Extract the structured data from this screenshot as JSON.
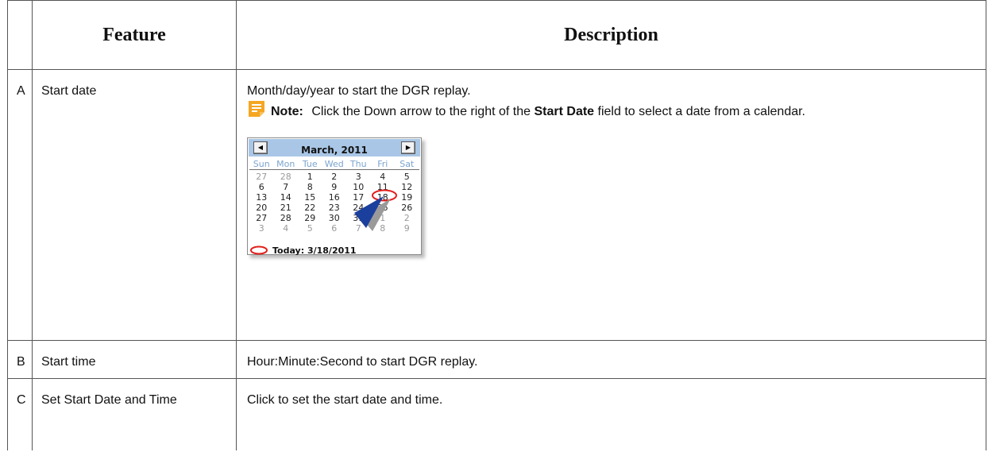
{
  "table": {
    "headers": [
      "",
      "Feature",
      "Description"
    ],
    "rows": [
      {
        "letter": "A",
        "feature": "Start date",
        "description": "Month/day/year to start the DGR replay.",
        "note": {
          "label": "Note:",
          "text_before": "Click the Down arrow to the right of the",
          "bold": "Start Date",
          "text_after": "field to select a date from a calendar."
        }
      },
      {
        "letter": "B",
        "feature": "Start time",
        "description": "Hour:Minute:Second to start DGR replay."
      },
      {
        "letter": "C",
        "feature": "Set Start Date and Time",
        "description": "Click to set the start date and time."
      }
    ]
  },
  "calendar": {
    "prev_glyph": "◀",
    "next_glyph": "▶",
    "title": "March, 2011",
    "weekdays": [
      "Sun",
      "Mon",
      "Tue",
      "Wed",
      "Thu",
      "Fri",
      "Sat"
    ],
    "weeks": [
      [
        "27",
        "28",
        "1",
        "2",
        "3",
        "4",
        "5"
      ],
      [
        "6",
        "7",
        "8",
        "9",
        "10",
        "11",
        "12"
      ],
      [
        "13",
        "14",
        "15",
        "16",
        "17",
        "18",
        "19"
      ],
      [
        "20",
        "21",
        "22",
        "23",
        "24",
        "25",
        "26"
      ],
      [
        "27",
        "28",
        "29",
        "30",
        "31",
        "1",
        "2"
      ],
      [
        "3",
        "4",
        "5",
        "6",
        "7",
        "8",
        "9"
      ]
    ],
    "muted_cells": [
      "0-0",
      "0-1",
      "4-5",
      "4-6",
      "5-0",
      "5-1",
      "5-2",
      "5-3",
      "5-4",
      "5-5",
      "5-6"
    ],
    "today_label": "Today: 3/18/2011",
    "selected_day": "18"
  },
  "colors": {
    "note_icon": "#f5a623",
    "header_bar": "#a9c6e6",
    "today_circle": "#e0201b",
    "arrow": "#1b3f9c"
  },
  "icons": {
    "note": "note-icon",
    "arrow_left": "left-arrow-icon",
    "arrow_right": "right-arrow-icon",
    "pointer": "pointer-arrow-icon",
    "today_marker": "today-circle-icon"
  }
}
